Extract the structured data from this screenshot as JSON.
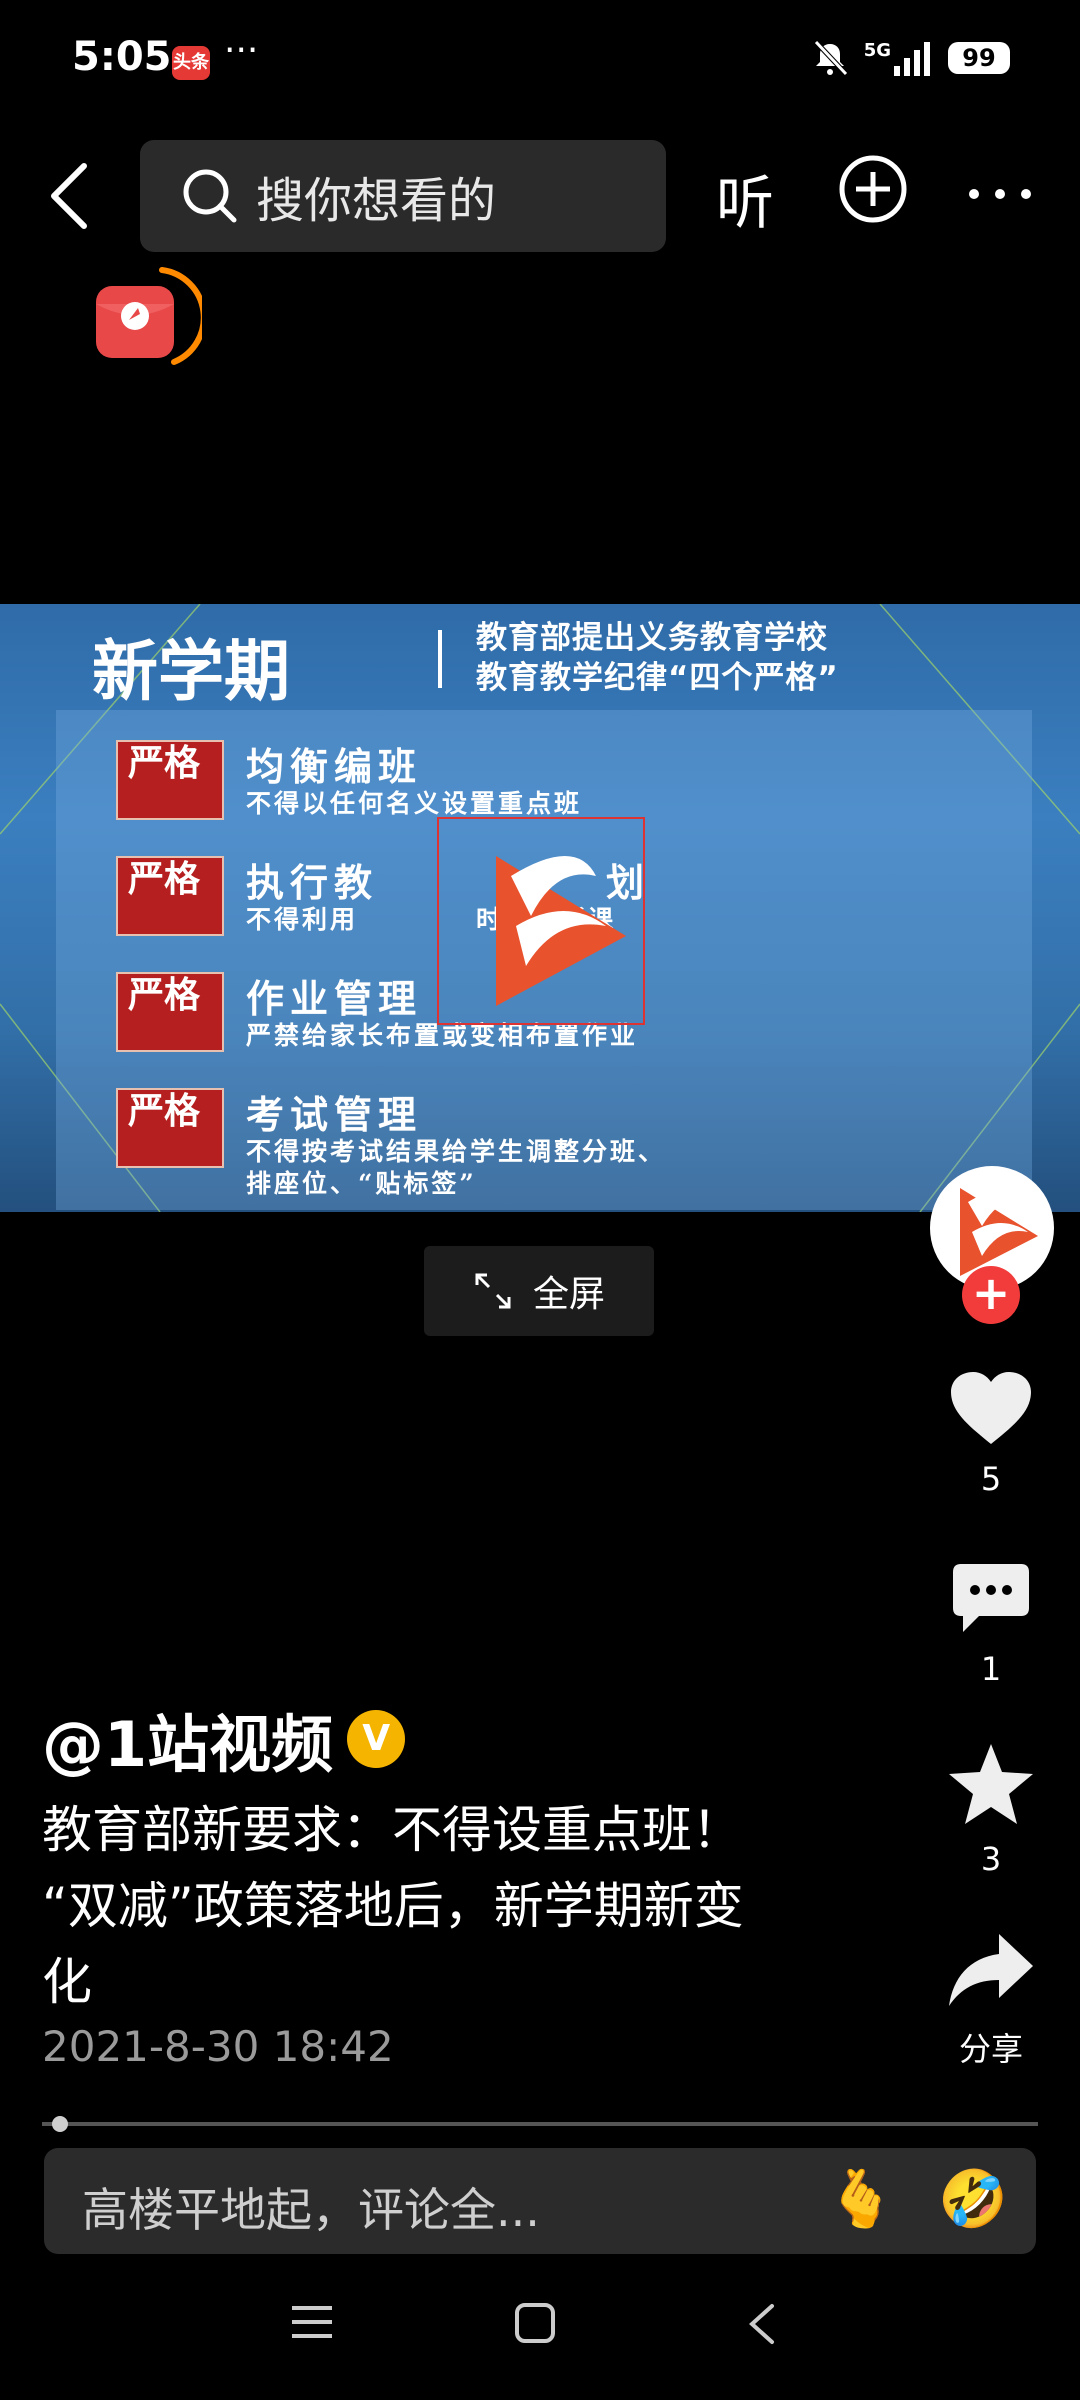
{
  "status_bar": {
    "time": "5:05",
    "app_badge": "头条",
    "more": "···",
    "network": "5G",
    "battery": "99"
  },
  "header": {
    "search_placeholder": "搜你想看的",
    "listen_label": "听"
  },
  "video": {
    "title": "新学期",
    "subtitle_line1": "教育部提出义务教育学校",
    "subtitle_line2": "教育教学纪律“四个严格”",
    "badge_text": "严格",
    "rows": [
      {
        "title": "均衡编班",
        "desc": "不得以任何名义设置重点班"
      },
      {
        "title": "执行教",
        "title_end": "划",
        "desc": "不得利用",
        "desc_end": "时间讲新课"
      },
      {
        "title": "作业管理",
        "desc": "严禁给家长布置或变相布置作业"
      },
      {
        "title": "考试管理",
        "desc": "不得按考试结果给学生调整分班、",
        "desc2": "排座位、“贴标签”"
      }
    ],
    "fullscreen_label": "全屏"
  },
  "actions": {
    "like_count": "5",
    "comment_count": "1",
    "favorite_count": "3",
    "share_label": "分享"
  },
  "post": {
    "author": "@1站视频",
    "verified_mark": "V",
    "caption_line1": "教育部新要求：不得设重点班！",
    "caption_line2": "“双减”政策落地后，新学期新变",
    "caption_line3": "化",
    "date": "2021-8-30 18:42",
    "progress": 0.01
  },
  "comment": {
    "placeholder": "高楼平地起，评论全...",
    "emoji1": "🫰",
    "emoji2": "🤣"
  },
  "colors": {
    "accent_red": "#f23c3c",
    "verified_gold": "#f4b400",
    "video_blue": "#3b7fc0"
  }
}
